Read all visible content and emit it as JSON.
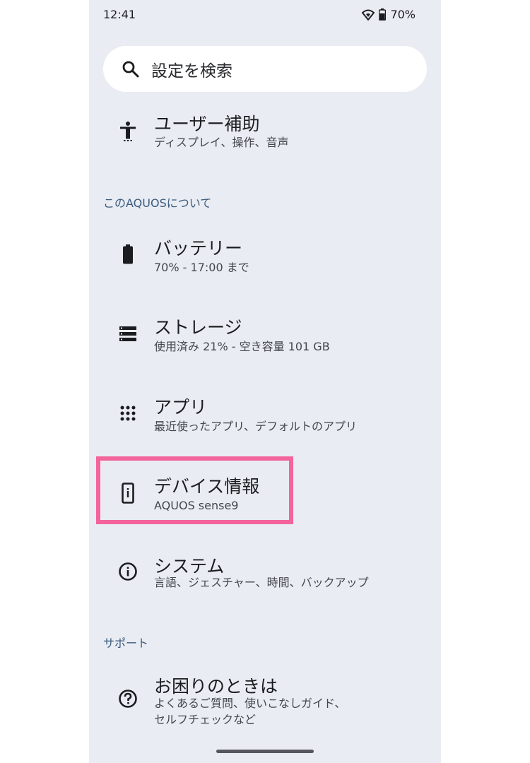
{
  "status": {
    "time": "12:41",
    "battery": "70%"
  },
  "search": {
    "placeholder": "設定を検索"
  },
  "items": [
    {
      "title": "ユーザー補助",
      "subtitle": "ディスプレイ、操作、音声",
      "icon": "accessibility-icon"
    },
    {
      "title": "バッテリー",
      "subtitle": "70% - 17:00 まで",
      "icon": "battery-icon"
    },
    {
      "title": "ストレージ",
      "subtitle": "使用済み 21% - 空き容量 101 GB",
      "icon": "storage-icon"
    },
    {
      "title": "アプリ",
      "subtitle": "最近使ったアプリ、デフォルトのアプリ",
      "icon": "apps-grid-icon"
    },
    {
      "title": "デバイス情報",
      "subtitle": "AQUOS sense9",
      "icon": "device-info-icon"
    },
    {
      "title": "システム",
      "subtitle": "言語、ジェスチャー、時間、バックアップ",
      "icon": "info-icon"
    },
    {
      "title": "お困りのときは",
      "subtitle1": "よくあるご質問、使いこなしガイド、",
      "subtitle2": "セルフチェックなど",
      "icon": "help-icon"
    }
  ],
  "sections": {
    "about": "このAQUOSについて",
    "support": "サポート"
  },
  "colors": {
    "background": "#e9ecf2",
    "highlight": "#f3649a",
    "section": "#3b5b80"
  }
}
